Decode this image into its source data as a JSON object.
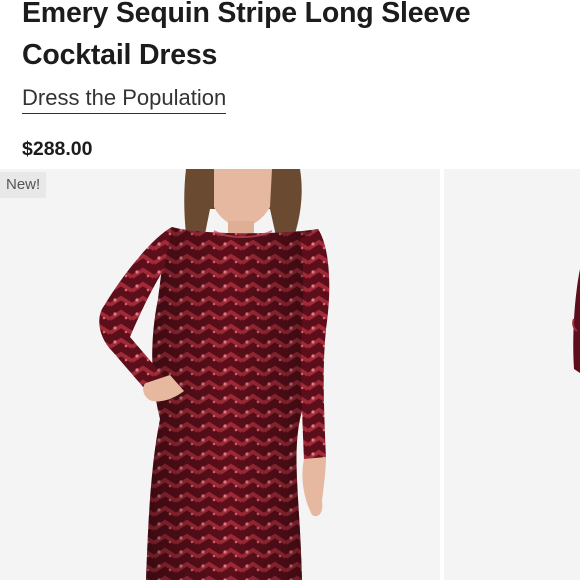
{
  "product": {
    "title": "Emery Sequin Stripe Long Sleeve Cocktail Dress",
    "brand": "Dress the Population",
    "price": "$288.00"
  },
  "gallery": {
    "badge": "New!",
    "images": [
      {
        "description": "Model wearing burgundy sequin stripe long sleeve cocktail dress, front view"
      },
      {
        "description": "Partial view of next product image"
      }
    ]
  },
  "colors": {
    "dress": "#6e1420",
    "dress_highlight": "#b8323f",
    "image_background": "#f4f4f4",
    "badge_background": "#e8e8e8"
  }
}
